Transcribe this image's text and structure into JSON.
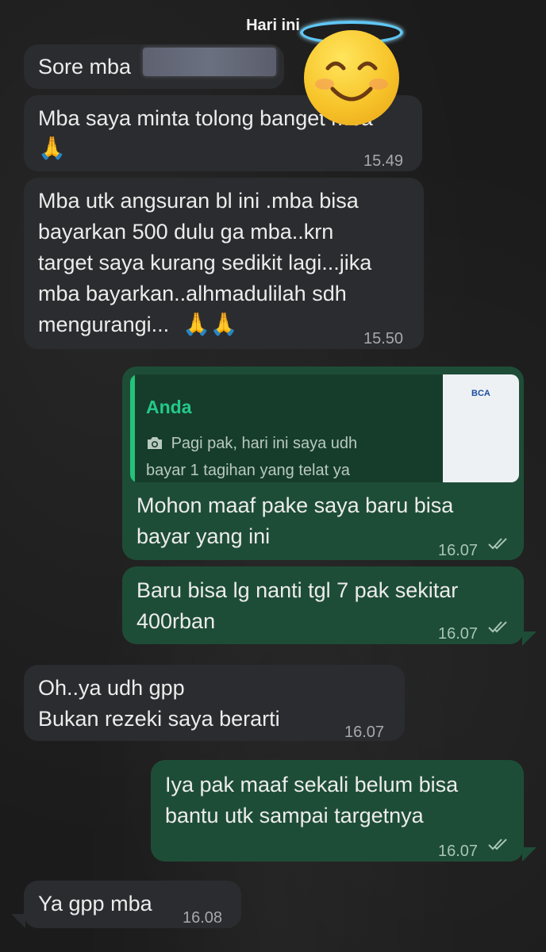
{
  "date_label": "Hari ini",
  "messages": [
    {
      "sender": "in",
      "lines": [
        "Sore mba"
      ],
      "time": ""
    },
    {
      "sender": "in",
      "lines": [
        "Mba saya minta tolong banget mba"
      ],
      "emoji": "🙏",
      "time": "15.49"
    },
    {
      "sender": "in",
      "lines": [
        "Mba utk angsuran bl ini .mba bisa",
        "bayarkan 500 dulu ga mba..krn",
        "target saya kurang sedikit lagi...jika",
        "mba bayarkan..alhmadulilah sdh",
        "mengurangi..."
      ],
      "emoji": "🙏🙏",
      "time": "15.50"
    },
    {
      "sender": "out",
      "reply": {
        "name": "Anda",
        "lines": [
          "Pagi pak, hari ini saya udh",
          "bayar 1 tagihan yang telat ya"
        ],
        "thumb_text": "BCA"
      },
      "lines": [
        "Mohon maaf pake saya baru bisa",
        "bayar yang ini"
      ],
      "time": "16.07"
    },
    {
      "sender": "out",
      "lines": [
        "Baru bisa lg nanti tgl 7 pak sekitar",
        "400rban"
      ],
      "time": "16.07"
    },
    {
      "sender": "in",
      "lines": [
        "Oh..ya udh gpp",
        "Bukan rezeki saya berarti"
      ],
      "time": "16.07"
    },
    {
      "sender": "out",
      "lines": [
        "Iya pak maaf sekali belum bisa",
        "bantu utk sampai targetnya"
      ],
      "time": "16.07"
    },
    {
      "sender": "in",
      "lines": [
        "Ya gpp mba"
      ],
      "time": "16.08"
    }
  ],
  "icons": {
    "camera": "camera-icon",
    "read_receipt": "double-check-icon",
    "pray": "folded-hands-emoji",
    "halo": "smiling-face-with-halo-emoji"
  },
  "colors": {
    "incoming": "#2b2c2f",
    "outgoing": "#1e4d37",
    "reply_name": "#25c98a",
    "background": "#1b1b1b"
  }
}
